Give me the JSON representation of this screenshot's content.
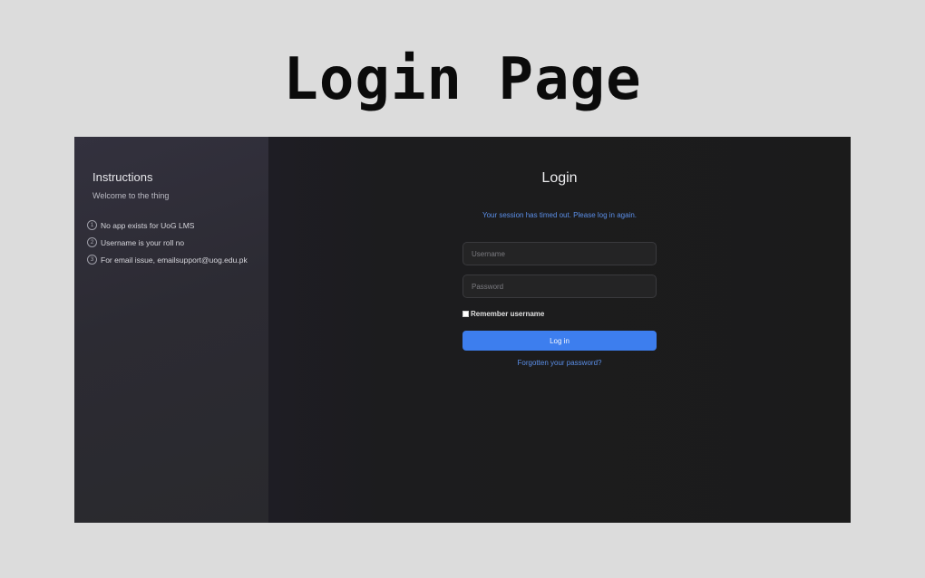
{
  "page_title": "Login Page",
  "sidebar": {
    "title": "Instructions",
    "subtitle": "Welcome to the thing",
    "items": [
      {
        "number": "1",
        "text": "No app exists for UoG LMS"
      },
      {
        "number": "2",
        "text": "Username is your roll no"
      },
      {
        "number": "3",
        "text": "For email issue, emailsupport@uog.edu.pk"
      }
    ]
  },
  "login": {
    "title": "Login",
    "session_message": "Your session has timed out. Please log in again.",
    "username_placeholder": "Username",
    "password_placeholder": "Password",
    "remember_label": "Remember username",
    "login_button_label": "Log in",
    "forgot_link": "Forgotten your password?"
  },
  "colors": {
    "accent": "#3d7eee",
    "link": "#5b8fe8",
    "background": "#1b1b1c",
    "sidebar": "#2c2b33"
  }
}
